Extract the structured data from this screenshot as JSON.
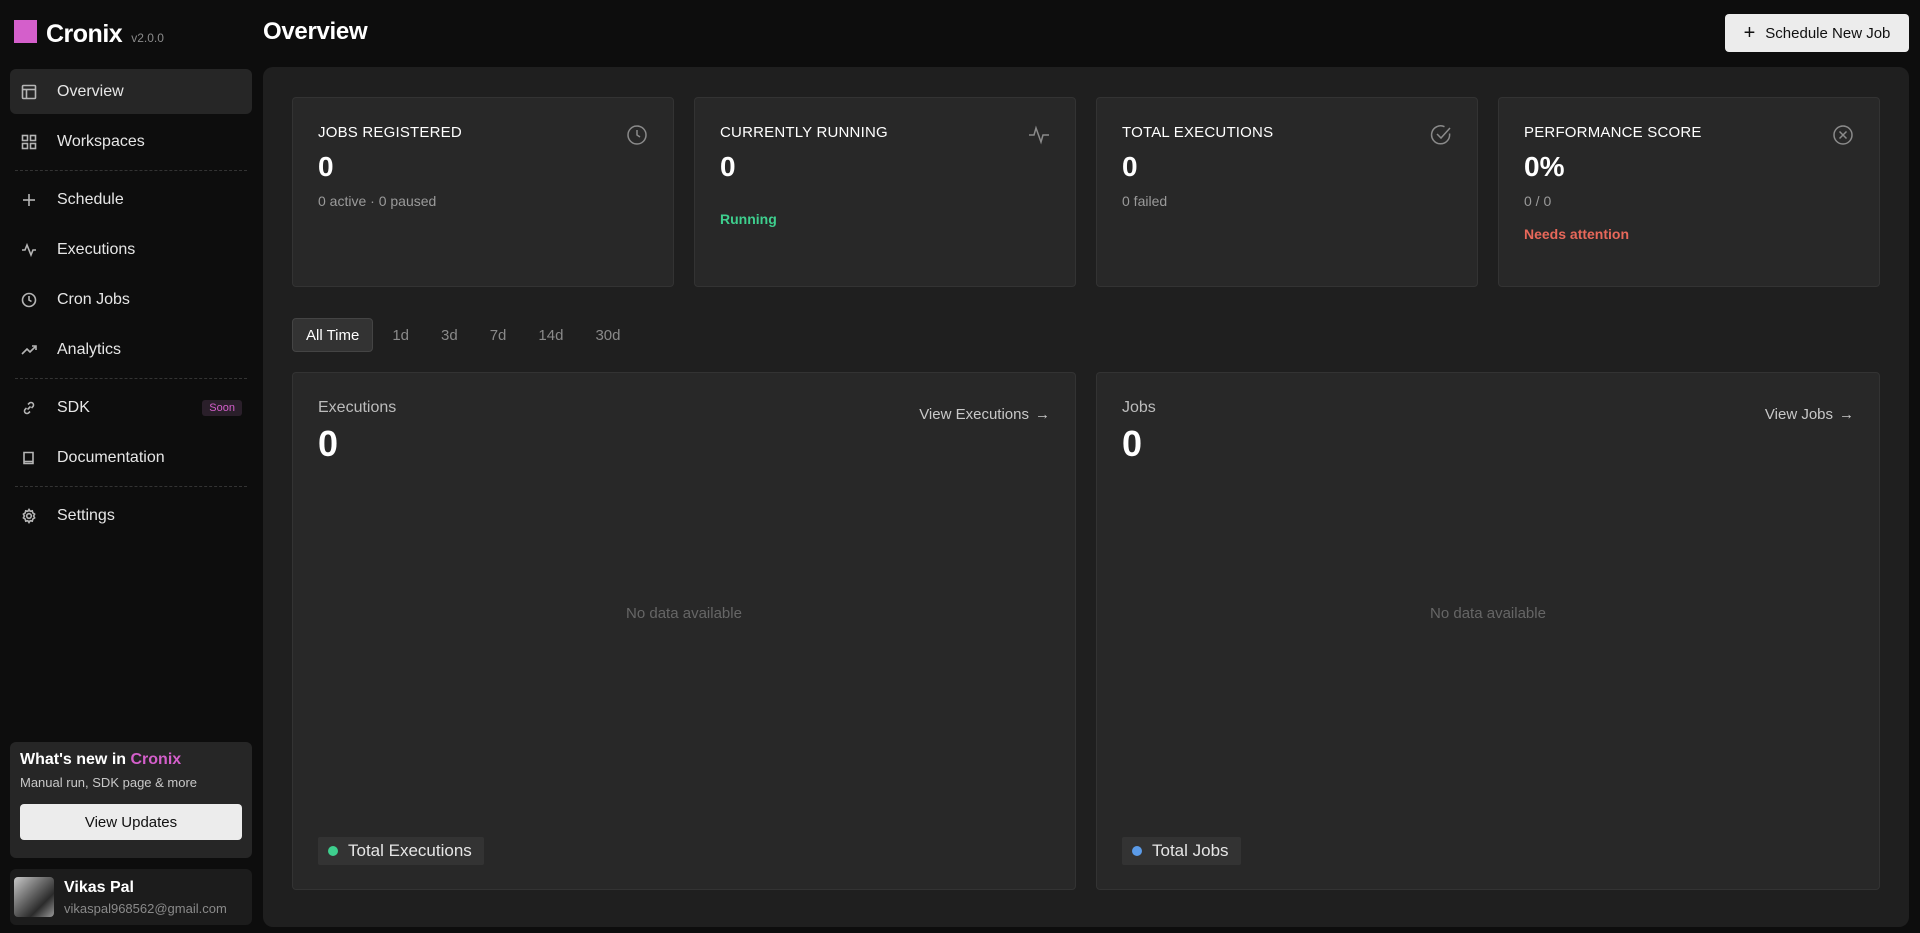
{
  "brand": {
    "name": "Cronix",
    "version": "v2.0.0"
  },
  "header": {
    "title": "Overview",
    "schedule_button": "Schedule New Job"
  },
  "sidebar": {
    "items": [
      {
        "label": "Overview"
      },
      {
        "label": "Workspaces"
      },
      {
        "label": "Schedule"
      },
      {
        "label": "Executions"
      },
      {
        "label": "Cron Jobs"
      },
      {
        "label": "Analytics"
      },
      {
        "label": "SDK",
        "badge": "Soon"
      },
      {
        "label": "Documentation"
      },
      {
        "label": "Settings"
      }
    ]
  },
  "promo": {
    "title_prefix": "What's new in ",
    "title_accent": "Cronix",
    "subtitle": "Manual run, SDK page & more",
    "button": "View Updates"
  },
  "user": {
    "name": "Vikas Pal",
    "email": "vikaspal968562@gmail.com"
  },
  "stats": [
    {
      "label": "Jobs Registered",
      "value": "0",
      "sub": "0 active · 0 paused",
      "icon": "clock-icon"
    },
    {
      "label": "Currently Running",
      "value": "0",
      "note": "Running",
      "note_color": "#3ecf8e",
      "icon": "activity-icon"
    },
    {
      "label": "Total Executions",
      "value": "0",
      "sub": "0 failed",
      "icon": "check-circle-icon"
    },
    {
      "label": "Performance Score",
      "value": "0%",
      "sub": "0 / 0",
      "note": "Needs attention",
      "note_color": "#e8685a",
      "icon": "x-circle-icon"
    }
  ],
  "range_tabs": [
    "All Time",
    "1d",
    "3d",
    "7d",
    "14d",
    "30d"
  ],
  "panels": {
    "executions": {
      "label": "Executions",
      "value": "0",
      "link": "View Executions",
      "empty": "No data available",
      "legend": "Total Executions",
      "legend_color": "#3ecf8e"
    },
    "jobs": {
      "label": "Jobs",
      "value": "0",
      "link": "View Jobs",
      "empty": "No data available",
      "legend": "Total Jobs",
      "legend_color": "#5b9be8"
    }
  },
  "colors": {
    "accent": "#d45fcb",
    "success": "#3ecf8e",
    "danger": "#e8685a",
    "info": "#5b9be8"
  }
}
